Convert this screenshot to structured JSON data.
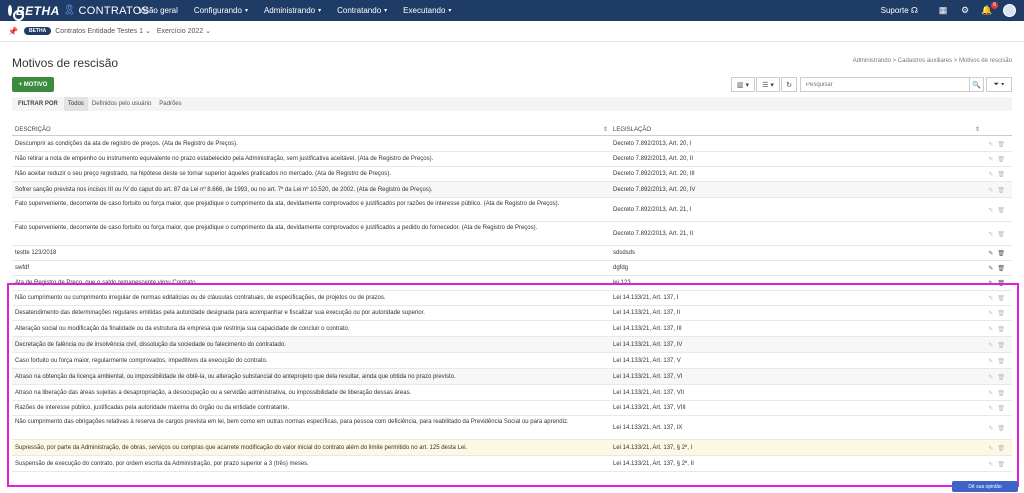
{
  "brand": {
    "name": "BETHA",
    "product": "CONTRATOS"
  },
  "nav": [
    {
      "label": "Visão geral",
      "caret": false
    },
    {
      "label": "Configurando",
      "caret": true
    },
    {
      "label": "Administrando",
      "caret": true
    },
    {
      "label": "Contratando",
      "caret": true
    },
    {
      "label": "Executando",
      "caret": true
    }
  ],
  "topRight": {
    "suporte": "Suporte",
    "notifications": "6"
  },
  "context": {
    "entity": "Contratos Entidade Testes 1",
    "exercise": "Exercício 2022",
    "logo": "BETHA"
  },
  "page": {
    "title": "Motivos de rescisão",
    "breadcrumb": "Administrando > Cadastros auxiliares > Motivos de rescisão",
    "addButton": "+ MOTIVO",
    "searchPlaceholder": "Pesquisar"
  },
  "filters": {
    "label": "FILTRAR POR",
    "options": [
      "Todos",
      "Definidos pelo usuário",
      "Padrões"
    ],
    "active": 0
  },
  "table": {
    "headers": {
      "description": "DESCRIÇÃO",
      "legislation": "LEGISLAÇÃO"
    },
    "rows": [
      {
        "description": "Descumprir as condições da ata de registro de preços. (Ata de Registro de Preços).",
        "legislation": "Decreto 7.892/2013, Art. 20, I",
        "editable": false,
        "h": 15
      },
      {
        "description": "Não retirar a nota de empenho ou instrumento equivalente no prazo estabelecido pela Administração, sem justificativa aceitável. (Ata de Registro de Preços).",
        "legislation": "Decreto 7.892/2013, Art. 20, II",
        "editable": false,
        "h": 15
      },
      {
        "description": "Não aceitar reduzir o seu preço registrado, na hipótese deste se tornar superior àqueles praticados no mercado. (Ata de Registro de Preços).",
        "legislation": "Decreto 7.892/2013, Art. 20, III",
        "editable": false,
        "h": 15
      },
      {
        "description": "Sofrer sanção prevista nos incisos III ou IV do caput do art. 87 da Lei nº 8.666, de 1993, ou no art. 7º da Lei nº 10.520, de 2002. (Ata de Registro de Preços).",
        "legislation": "Decreto 7.892/2013, Art. 20, IV",
        "editable": false,
        "h": 16
      },
      {
        "description": "Fato superveniente, decorrente de caso fortuito ou força maior, que prejudique o cumprimento da ata, devidamente comprovados e justificados por razões de interesse público. (Ata de Registro de Preços).",
        "legislation": "Decreto 7.892/2013, Art. 21, I",
        "editable": false,
        "h": 24
      },
      {
        "description": "Fato superveniente, decorrente de caso fortuito ou força maior, que prejudique o cumprimento da ata, devidamente comprovados e justificados a pedido do fornecedor. (Ata de Registro de Preços).",
        "legislation": "Decreto 7.892/2013, Art. 21, II",
        "editable": false,
        "h": 24
      },
      {
        "description": "testte 123/2018",
        "legislation": "sdsdsds",
        "editable": true,
        "h": 15
      },
      {
        "description": "swfdf",
        "legislation": "dgfdg",
        "editable": true,
        "h": 15
      },
      {
        "description": "Ata de Registro de Preço, que o saldo remanescente virou Contrato",
        "legislation": "lei 123",
        "editable": true,
        "h": 15
      },
      {
        "description": "Não cumprimento ou cumprimento irregular de normas editalícias ou de cláusulas contratuais, de especificações, de projetos ou de prazos.",
        "legislation": "Lei 14.133/21, Art. 137, I",
        "editable": false,
        "h": 15
      },
      {
        "description": "Desatendimento das determinações regulares emitidas pela autoridade designada para acompanhar e fiscalizar sua execução ou por autoridade superior.",
        "legislation": "Lei 14.133/21, Art. 137, II",
        "editable": false,
        "h": 15
      },
      {
        "description": "Alteração social ou modificação da finalidade ou da estrutura da empresa que restrinja sua capacidade de concluir o contrato.",
        "legislation": "Lei 14.133/21, Art. 137, III",
        "editable": false,
        "h": 16
      },
      {
        "description": "Decretação de falência ou de insolvência civil, dissolução da sociedade ou falecimento do contratado.",
        "legislation": "Lei 14.133/21, Art. 137, IV",
        "editable": false,
        "h": 16
      },
      {
        "description": "Caso fortuito ou força maior, regularmente comprovados, impeditivos da execução do contrato.",
        "legislation": "Lei 14.133/21, Art. 137, V",
        "editable": false,
        "h": 16
      },
      {
        "description": "Atraso na obtenção da licença ambiental, ou impossibilidade de obtê-la, ou alteração substancial do anteprojeto que dela resultar, ainda que obtida no prazo previsto.",
        "legislation": "Lei 14.133/21, Art. 137, VI",
        "editable": false,
        "h": 16
      },
      {
        "description": "Atraso na liberação das áreas sujeitas a desapropriação, a desocupação ou a servidão administrativa, ou impossibilidade de liberação dessas áreas.",
        "legislation": "Lei 14.133/21, Art. 137, VII",
        "editable": false,
        "h": 16
      },
      {
        "description": "Razões de interesse público, justificadas pela autoridade máxima do órgão ou da entidade contratante.",
        "legislation": "Lei 14.133/21, Art. 137, VIII",
        "editable": false,
        "h": 15
      },
      {
        "description": "Não cumprimento das obrigações relativas à reserva de cargos prevista em lei, bem como em outras normas específicas, para pessoa com deficiência, para reabilitado da Previdência Social ou para aprendiz.",
        "legislation": "Lei 14.133/21, Art. 137, IX",
        "editable": false,
        "h": 24
      },
      {
        "description": "Supressão, por parte da Administração, de obras, serviços ou compras que acarrete modificação do valor inicial do contrato além do limite permitido no art. 125 desta Lei.",
        "legislation": "Lei 14.133/21, Art. 137, § 2º, I",
        "editable": false,
        "h": 16
      },
      {
        "description": "Suspensão de execução do contrato, por ordem escrita da Administração, por prazo superior a 3 (três) meses.",
        "legislation": "Lei 14.133/21, Art. 137, § 2º, II",
        "editable": false,
        "h": 16
      }
    ]
  },
  "floatButton": "Dê sua opinião"
}
